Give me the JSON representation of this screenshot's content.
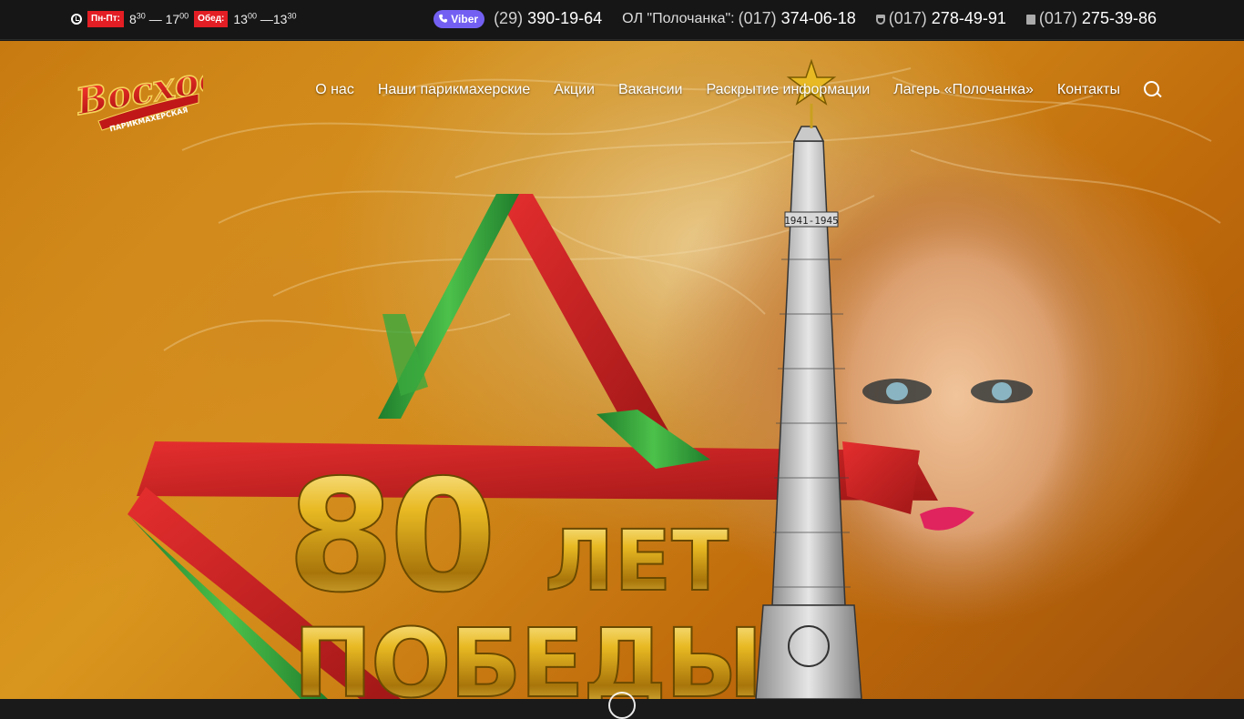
{
  "topbar": {
    "days_badge": "Пн-Пт:",
    "work_from_h": "8",
    "work_from_m": "30",
    "work_to_h": "17",
    "work_to_m": "00",
    "lunch_badge": "Обед:",
    "lunch_from_h": "13",
    "lunch_from_m": "00",
    "lunch_to_h": "13",
    "lunch_to_m": "30",
    "dash": "—",
    "viber_label": "Viber",
    "phones": [
      {
        "code": "(29)",
        "number": "390-19-64"
      },
      {
        "label": "ОЛ \"Полочанка\":",
        "code": "(017)",
        "number": "374-06-18"
      },
      {
        "code": "(017)",
        "number": "278-49-91"
      },
      {
        "code": "(017)",
        "number": "275-39-86"
      }
    ]
  },
  "logo": {
    "name": "Восход",
    "sub": "ПАРИКМАХЕРСКАЯ"
  },
  "nav": {
    "items": [
      "О нас",
      "Наши парикмахерские",
      "Акции",
      "Вакансии",
      "Раскрытие информации",
      "Лагерь «Полочанка»",
      "Контакты"
    ]
  },
  "banner": {
    "number": "80",
    "word1": "ЛЕТ",
    "word2": "ПОБЕДЫ",
    "monument_years": "1941-1945"
  },
  "colors": {
    "accent": "#e31e24",
    "viber": "#7360f2",
    "topbar_bg": "#161616",
    "star_red": "#d6262a",
    "star_green": "#2f9a3a"
  }
}
